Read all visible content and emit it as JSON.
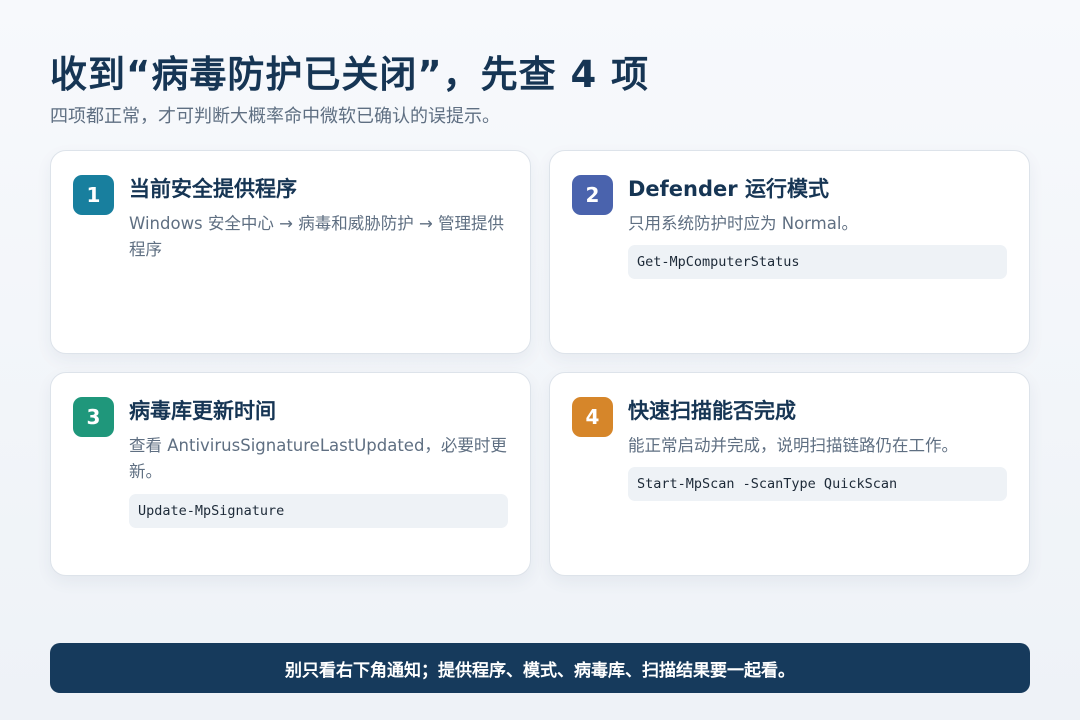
{
  "header": {
    "title": "收到“病毒防护已关闭”，先查 4 项",
    "subtitle": "四项都正常，才可判断大概率命中微软已确认的误提示。"
  },
  "cards": [
    {
      "number": "1",
      "title": "当前安全提供程序",
      "description": "Windows 安全中心 → 病毒和威胁防护 → 管理提供程序",
      "badge_color": "#187f9e"
    },
    {
      "number": "2",
      "title": "Defender 运行模式",
      "description": "只用系统防护时应为 Normal。",
      "code": "Get-MpComputerStatus",
      "badge_color": "#4a63ad"
    },
    {
      "number": "3",
      "title": "病毒库更新时间",
      "description": "查看 AntivirusSignatureLastUpdated，必要时更新。",
      "code": "Update-MpSignature",
      "badge_color": "#1f977b"
    },
    {
      "number": "4",
      "title": "快速扫描能否完成",
      "description": "能正常启动并完成，说明扫描链路仍在工作。",
      "code": "Start-MpScan -ScanType QuickScan",
      "badge_color": "#d6862a"
    }
  ],
  "footer": {
    "text": "别只看右下角通知；提供程序、模式、病毒库、扫描结果要一起看。"
  }
}
